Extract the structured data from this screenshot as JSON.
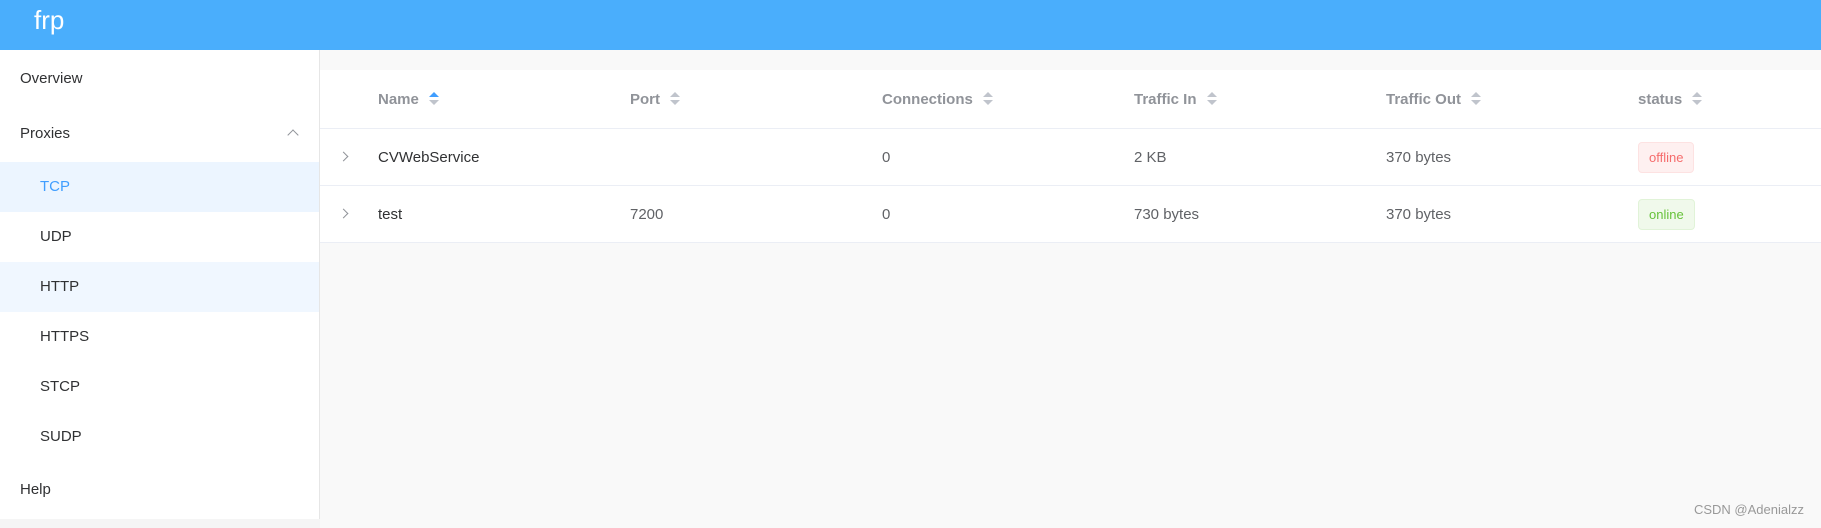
{
  "header": {
    "brand": "frp"
  },
  "sidebar": {
    "overview": "Overview",
    "proxies": "Proxies",
    "sub_items": [
      "TCP",
      "UDP",
      "HTTP",
      "HTTPS",
      "STCP",
      "SUDP"
    ],
    "help": "Help",
    "active": "TCP"
  },
  "table": {
    "columns": [
      "Name",
      "Port",
      "Connections",
      "Traffic In",
      "Traffic Out",
      "status"
    ],
    "sorted_column": "Name",
    "rows": [
      {
        "name": "CVWebService",
        "port": "",
        "connections": "0",
        "traffic_in": "2 KB",
        "traffic_out": "370 bytes",
        "status": "offline"
      },
      {
        "name": "test",
        "port": "7200",
        "connections": "0",
        "traffic_in": "730 bytes",
        "traffic_out": "370 bytes",
        "status": "online"
      }
    ]
  },
  "watermark": "CSDN @Adenialzz",
  "colors": {
    "header": "#4aaefc",
    "accent": "#409eff",
    "offline": "#f56c6c",
    "online": "#67c23a"
  }
}
